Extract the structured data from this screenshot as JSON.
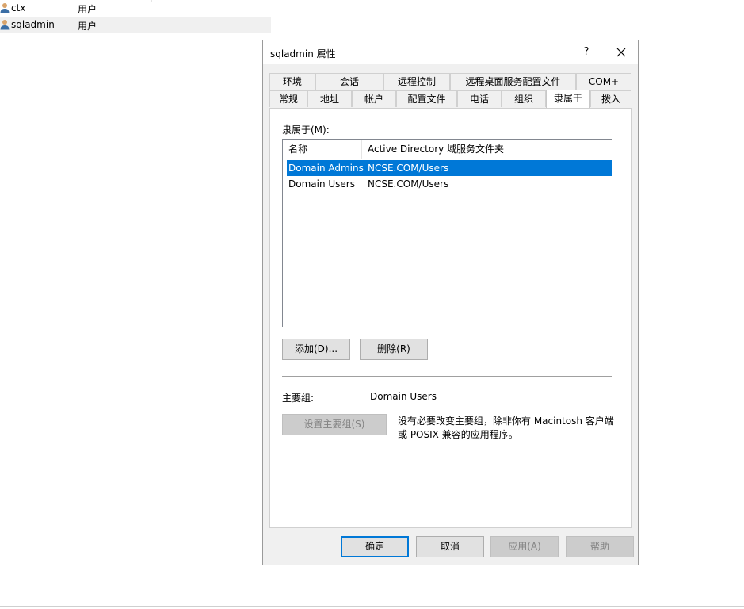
{
  "background_list": {
    "rows": [
      {
        "name": "ctx",
        "type": "用户",
        "selected": false
      },
      {
        "name": "sqladmin",
        "type": "用户",
        "selected": true
      }
    ]
  },
  "dialog": {
    "title": "sqladmin 属性",
    "help": "?",
    "close_icon": "close-icon",
    "tabs_row1": [
      "环境",
      "会话",
      "远程控制",
      "远程桌面服务配置文件",
      "COM+"
    ],
    "tabs_row2": [
      "常规",
      "地址",
      "帐户",
      "配置文件",
      "电话",
      "组织",
      "隶属于",
      "拨入"
    ],
    "active_tab": "隶属于",
    "member_of_label": "隶属于(M):",
    "list": {
      "columns": [
        "名称",
        "Active Directory 域服务文件夹"
      ],
      "rows": [
        [
          "Domain Admins",
          "NCSE.COM/Users"
        ],
        [
          "Domain Users",
          "NCSE.COM/Users"
        ]
      ],
      "selected_row": 0
    },
    "add_button": "添加(D)...",
    "remove_button": "删除(R)",
    "primary_group_label": "主要组:",
    "primary_group_value": "Domain Users",
    "set_primary_button": "设置主要组(S)",
    "note": "没有必要改变主要组，除非你有 Macintosh 客户端或 POSIX 兼容的应用程序。",
    "footer": {
      "ok": "确定",
      "cancel": "取消",
      "apply": "应用(A)",
      "help": "帮助"
    },
    "colors": {
      "selection": "#0078d7",
      "dialog_bg": "#f0f0f0",
      "panel_bg": "#ffffff"
    }
  }
}
